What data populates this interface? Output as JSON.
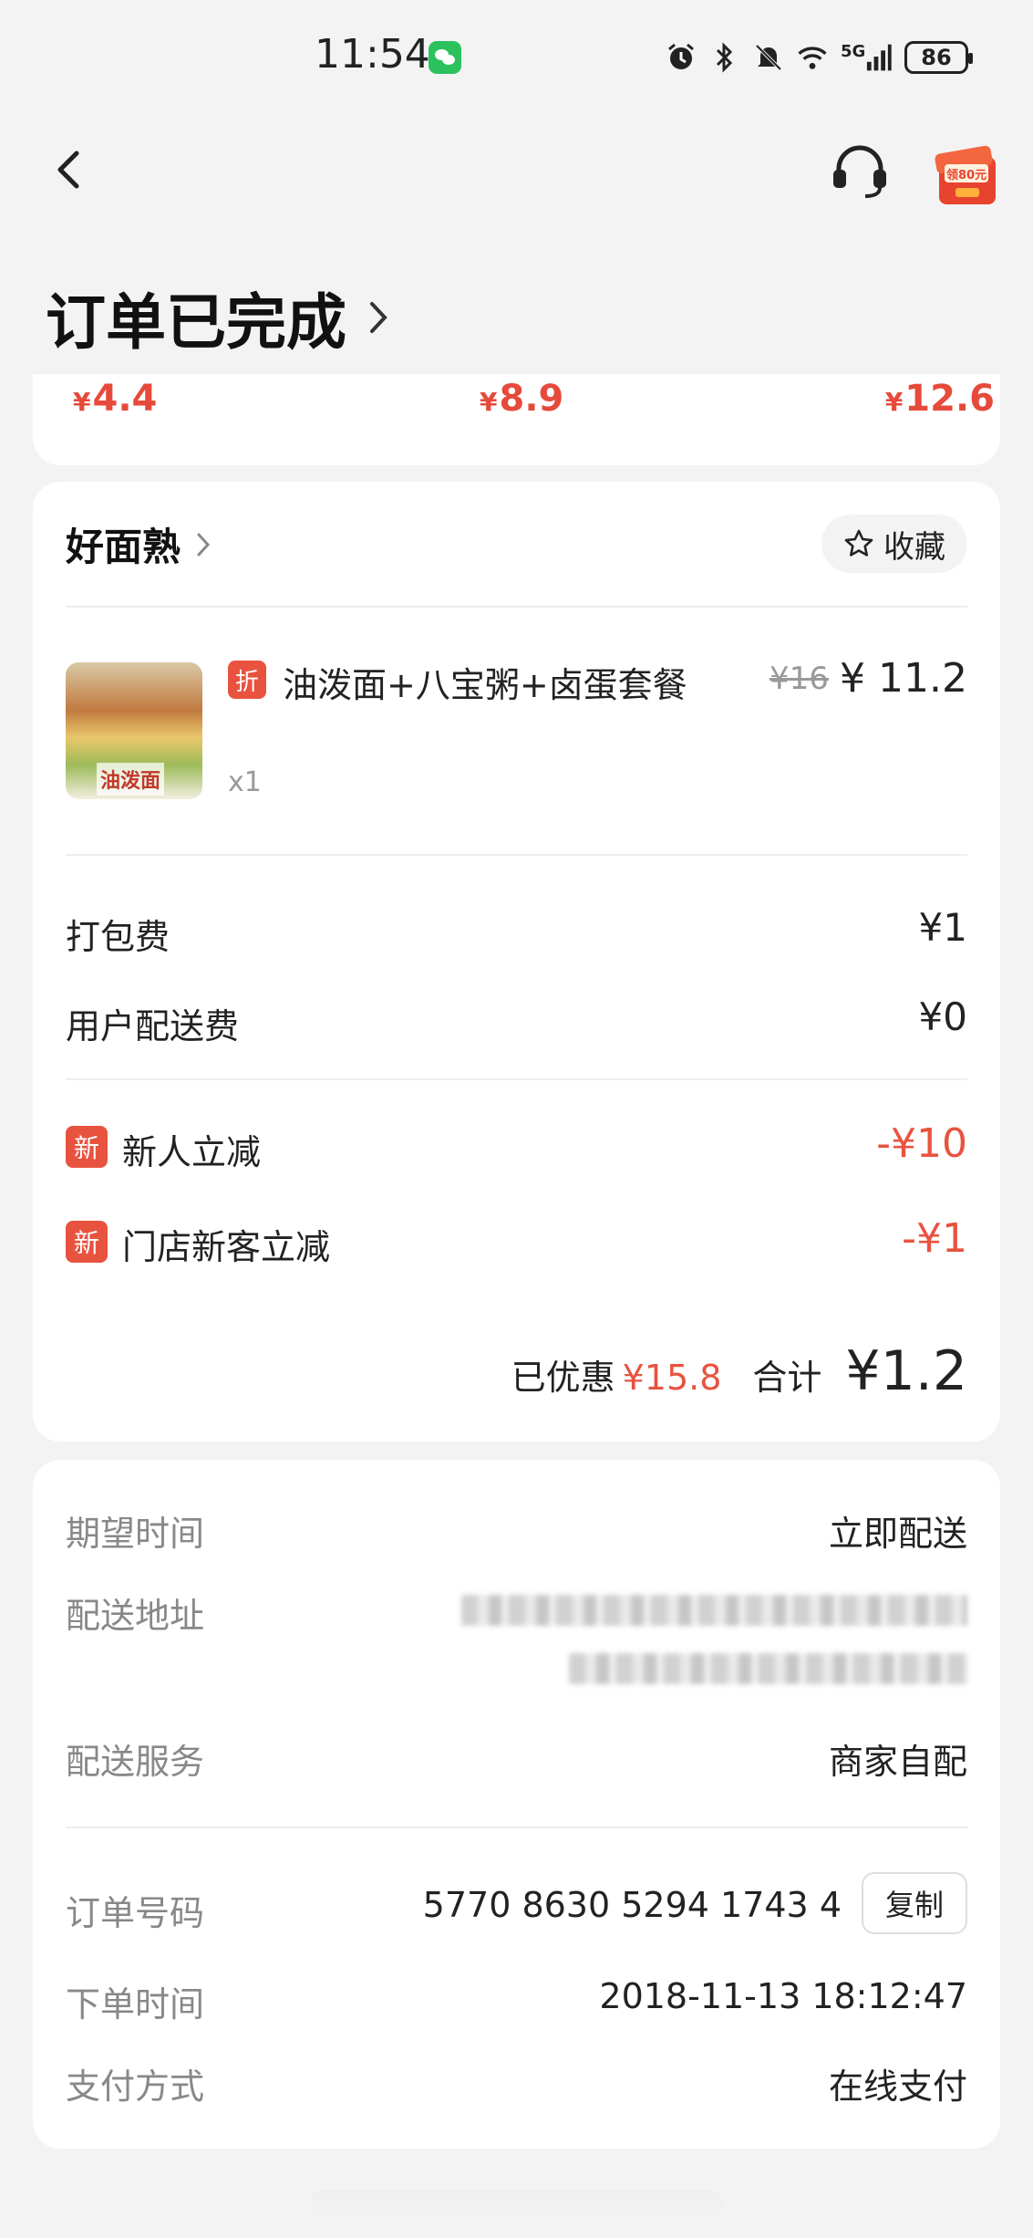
{
  "status_bar": {
    "time": "11:54",
    "signal_label": "5G",
    "battery": "86"
  },
  "header": {
    "title": "订单已完成",
    "gift_badge": "领80元"
  },
  "prev_card": {
    "prices": [
      {
        "symbol": "¥",
        "amount": "4.4"
      },
      {
        "symbol": "¥",
        "amount": "8.9"
      },
      {
        "symbol": "¥",
        "amount": "12.6"
      }
    ]
  },
  "order": {
    "shop_name": "好面熟",
    "favorite_label": "收藏",
    "item": {
      "tag": "折",
      "name": "油泼面+八宝粥+卤蛋套餐",
      "original_price": "¥16",
      "price": "¥ 11.2",
      "quantity": "x1",
      "image_label": "油泼面"
    },
    "fees": [
      {
        "label": "打包费",
        "value": "¥1"
      },
      {
        "label": "用户配送费",
        "value": "¥0"
      }
    ],
    "discounts": [
      {
        "tag": "新",
        "label": "新人立减",
        "value": "-¥10"
      },
      {
        "tag": "新",
        "label": "门店新客立减",
        "value": "-¥1"
      }
    ],
    "summary": {
      "saved_label": "已优惠",
      "saved_value": "¥15.8",
      "total_label": "合计",
      "total_value": "¥1.2"
    }
  },
  "delivery": {
    "expected_time_label": "期望时间",
    "expected_time_value": "立即配送",
    "address_label": "配送地址",
    "service_label": "配送服务",
    "service_value": "商家自配",
    "order_no_label": "订单号码",
    "order_no_value": "5770 8630 5294 1743 4",
    "copy_label": "复制",
    "order_time_label": "下单时间",
    "order_time_value": "2018-11-13 18:12:47",
    "payment_label": "支付方式",
    "payment_value": "在线支付"
  },
  "colors": {
    "accent_red": "#e8533f",
    "background": "#f3f3f3",
    "card": "#ffffff"
  }
}
